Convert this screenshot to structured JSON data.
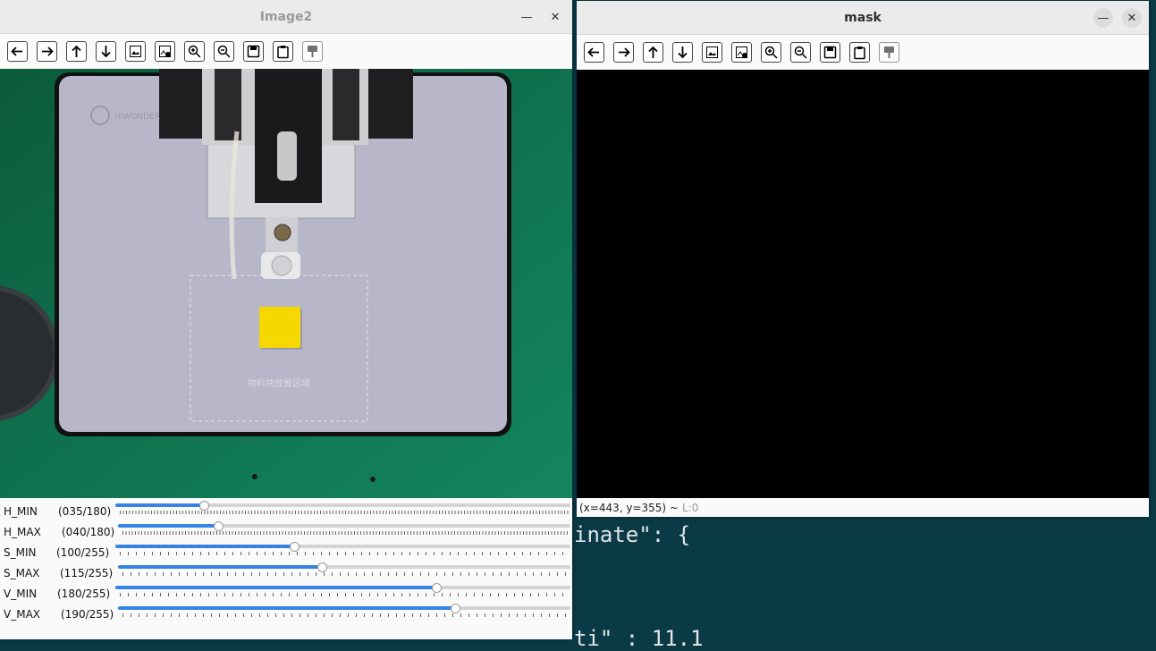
{
  "background_editor": {
    "lines": [
      "inate\": {",
      "ti\" : 11.1"
    ]
  },
  "image2_window": {
    "title": "Image2",
    "minimize_glyph": "—",
    "close_glyph": "✕",
    "toolbar": [
      "arrow-left-icon",
      "arrow-right-icon",
      "arrow-up-icon",
      "arrow-down-icon",
      "image-icon",
      "image-save-icon",
      "zoom-in-icon",
      "zoom-out-icon",
      "save-icon",
      "clipboard-icon",
      "properties-icon"
    ],
    "camera_label": "物料块放置区域",
    "trackbars": [
      {
        "name": "H_MIN",
        "value": "(035/180)",
        "level": 35,
        "max": 180
      },
      {
        "name": "H_MAX",
        "value": "(040/180)",
        "level": 40,
        "max": 180
      },
      {
        "name": "S_MIN",
        "value": "(100/255)",
        "level": 100,
        "max": 255
      },
      {
        "name": "S_MAX",
        "value": "(115/255)",
        "level": 115,
        "max": 255
      },
      {
        "name": "V_MIN",
        "value": "(180/255)",
        "level": 180,
        "max": 255
      },
      {
        "name": "V_MAX",
        "value": "(190/255)",
        "level": 190,
        "max": 255
      }
    ]
  },
  "mask_window": {
    "title": "mask",
    "minimize_glyph": "—",
    "close_glyph": "✕",
    "status_coords": "(x=443, y=355) ~",
    "status_level": "L:0"
  },
  "colors": {
    "accent": "#3584e4",
    "editor_bg": "#0a3a45",
    "mat_green": "#0f7a4e",
    "cube_yellow": "#f5d800"
  }
}
